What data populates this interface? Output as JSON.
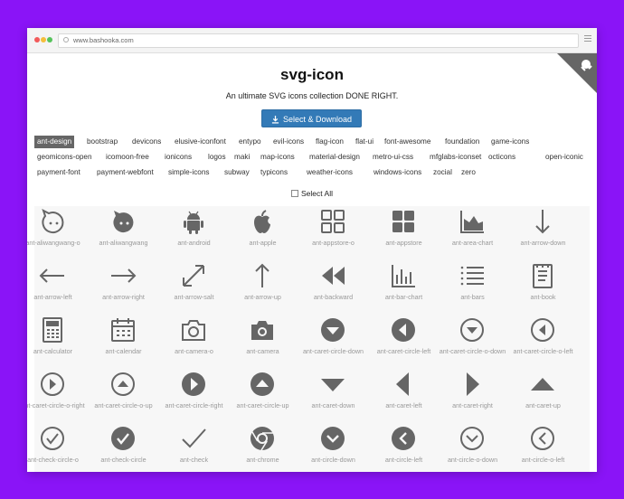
{
  "browser": {
    "url": "www.bashooka.com"
  },
  "page": {
    "title": "svg-icon",
    "subtitle": "An ultimate SVG icons collection DONE RIGHT.",
    "download_label": "Select & Download",
    "select_all_label": "Select All"
  },
  "icon_sets": [
    [
      "ant-design",
      "bootstrap",
      "devicons",
      "elusive-iconfont",
      "entypo",
      "evil-icons",
      "flag-icon",
      "flat-ui",
      "font-awesome",
      "foundation",
      "game-icons"
    ],
    [
      "geomicons-open",
      "icomoon-free",
      "ionicons",
      "logos",
      "maki",
      "map-icons",
      "material-design",
      "metro-ui-css",
      "mfglabs-iconset",
      "octicons",
      "open-iconic"
    ],
    [
      "payment-font",
      "payment-webfont",
      "simple-icons",
      "subway",
      "typicons",
      "weather-icons",
      "windows-icons",
      "zocial",
      "zero"
    ]
  ],
  "active_set": "ant-design",
  "icons": [
    "ant-aliwangwang-o",
    "ant-aliwangwang",
    "ant-android",
    "ant-apple",
    "ant-appstore-o",
    "ant-appstore",
    "ant-area-chart",
    "ant-arrow-down",
    "ant-arrow-left",
    "ant-arrow-right",
    "ant-arrow-salt",
    "ant-arrow-up",
    "ant-backward",
    "ant-bar-chart",
    "ant-bars",
    "ant-book",
    "ant-calculator",
    "ant-calendar",
    "ant-camera-o",
    "ant-camera",
    "ant-caret-circle-down",
    "ant-caret-circle-left",
    "ant-caret-circle-o-down",
    "ant-caret-circle-o-left",
    "ant-caret-circle-o-right",
    "ant-caret-circle-o-up",
    "ant-caret-circle-right",
    "ant-caret-circle-up",
    "ant-caret-down",
    "ant-caret-left",
    "ant-caret-right",
    "ant-caret-up",
    "ant-check-circle-o",
    "ant-check-circle",
    "ant-check",
    "ant-chrome",
    "ant-circle-down",
    "ant-circle-left",
    "ant-circle-o-down",
    "ant-circle-o-left"
  ],
  "colors": {
    "accent": "#337ab7",
    "background": "#8a14f7",
    "icon": "#666666",
    "active_tag": "#666666"
  }
}
